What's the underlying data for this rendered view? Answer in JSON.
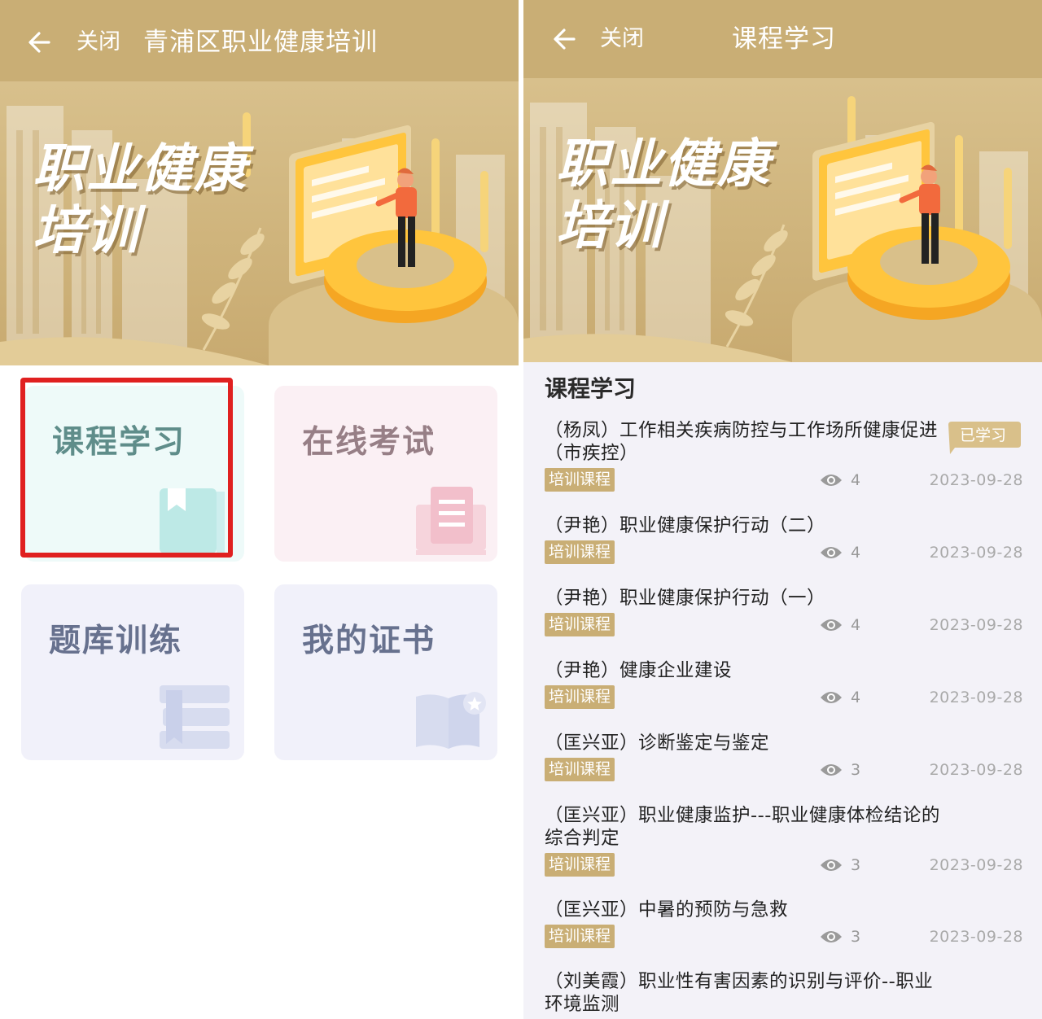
{
  "left": {
    "close_label": "关闭",
    "title": "青浦区职业健康培训",
    "banner": {
      "line1": "职业健康",
      "line2": "培训"
    },
    "menu": [
      {
        "label": "课程学习",
        "color": "#5f8d8a",
        "bg": "#eefaf9",
        "icon": "bookmark-book-icon"
      },
      {
        "label": "在线考试",
        "color": "#977f86",
        "bg": "#fbf0f4",
        "icon": "exam-paper-icon"
      },
      {
        "label": "题库训练",
        "color": "#67718e",
        "bg": "#f1f1fa",
        "icon": "book-stack-icon"
      },
      {
        "label": "我的证书",
        "color": "#67718e",
        "bg": "#f1f1fa",
        "icon": "certificate-book-icon"
      }
    ]
  },
  "right": {
    "close_label": "关闭",
    "title": "课程学习",
    "banner": {
      "line1": "职业健康",
      "line2": "培训"
    },
    "section_title": "课程学习",
    "learned_badge": "已学习",
    "courses": [
      {
        "title": "（杨凤）工作相关疾病防控与工作场所健康促进（市疾控）",
        "tag": "培训课程",
        "views": "4",
        "date": "2023-09-28",
        "learned": true
      },
      {
        "title": "（尹艳）职业健康保护行动（二）",
        "tag": "培训课程",
        "views": "4",
        "date": "2023-09-28"
      },
      {
        "title": "（尹艳）职业健康保护行动（一）",
        "tag": "培训课程",
        "views": "4",
        "date": "2023-09-28"
      },
      {
        "title": "（尹艳）健康企业建设",
        "tag": "培训课程",
        "views": "4",
        "date": "2023-09-28"
      },
      {
        "title": "（匡兴亚）诊断鉴定与鉴定",
        "tag": "培训课程",
        "views": "3",
        "date": "2023-09-28"
      },
      {
        "title": "（匡兴亚）职业健康监护---职业健康体检结论的综合判定",
        "tag": "培训课程",
        "views": "3",
        "date": "2023-09-28"
      },
      {
        "title": "（匡兴亚）中暑的预防与急救",
        "tag": "培训课程",
        "views": "3",
        "date": "2023-09-28"
      },
      {
        "title": "（刘美霞）职业性有害因素的识别与评价--职业环境监测",
        "tag": "",
        "views": "",
        "date": ""
      }
    ]
  },
  "colors": {
    "accent": "#c9ae75",
    "highlight": "#e02020"
  }
}
